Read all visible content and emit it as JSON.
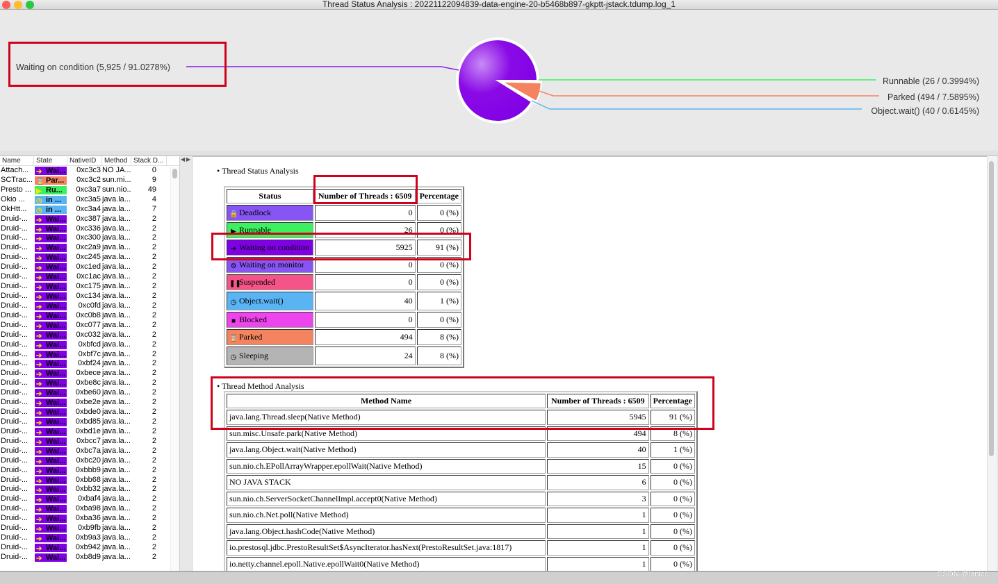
{
  "window": {
    "title": "Thread Status Analysis : 20221122094839-data-engine-20-b5468b897-gkptt-jstack.tdump.log_1"
  },
  "pie": {
    "labels": {
      "waiting": "Waiting on condition (5,925  / 91.0278%)",
      "runnable": "Runnable (26  / 0.3994%)",
      "parked": "Parked (494  / 7.5895%)",
      "objectwait": "Object.wait() (40  / 0.6145%)"
    },
    "slices": [
      {
        "name": "Runnable",
        "value": 26,
        "color": "#3cf060"
      },
      {
        "name": "Parked",
        "value": 494,
        "color": "#f4845f"
      },
      {
        "name": "Object.wait()",
        "value": 40,
        "color": "#5ab4f4"
      },
      {
        "name": "Waiting on condition",
        "value": 5925,
        "color": "#8000e6"
      }
    ]
  },
  "thread_list": {
    "columns": [
      "Name",
      "State",
      "NativeID",
      "Method",
      "Stack D..."
    ],
    "rows": [
      [
        "Attach...",
        "Wai...",
        "0xc3c3",
        "NO JA...",
        "0",
        "waiting"
      ],
      [
        "SCTrac...",
        "Par...",
        "0xc3c2",
        "sun.mi...",
        "9",
        "parked"
      ],
      [
        "Presto ...",
        "Ru...",
        "0xc3a7",
        "sun.nio...",
        "49",
        "runnable"
      ],
      [
        "Okio ...",
        "in ...",
        "0xc3a5",
        "java.la...",
        "4",
        "objectwait"
      ],
      [
        "OkHtt...",
        "in ...",
        "0xc3a4",
        "java.la...",
        "7",
        "objectwait"
      ],
      [
        "Druid-...",
        "Wai...",
        "0xc387",
        "java.la...",
        "2",
        "waiting"
      ],
      [
        "Druid-...",
        "Wai...",
        "0xc336",
        "java.la...",
        "2",
        "waiting"
      ],
      [
        "Druid-...",
        "Wai...",
        "0xc300",
        "java.la...",
        "2",
        "waiting"
      ],
      [
        "Druid-...",
        "Wai...",
        "0xc2a9",
        "java.la...",
        "2",
        "waiting"
      ],
      [
        "Druid-...",
        "Wai...",
        "0xc245",
        "java.la...",
        "2",
        "waiting"
      ],
      [
        "Druid-...",
        "Wai...",
        "0xc1ed",
        "java.la...",
        "2",
        "waiting"
      ],
      [
        "Druid-...",
        "Wai...",
        "0xc1ac",
        "java.la...",
        "2",
        "waiting"
      ],
      [
        "Druid-...",
        "Wai...",
        "0xc175",
        "java.la...",
        "2",
        "waiting"
      ],
      [
        "Druid-...",
        "Wai...",
        "0xc134",
        "java.la...",
        "2",
        "waiting"
      ],
      [
        "Druid-...",
        "Wai...",
        "0xc0fd",
        "java.la...",
        "2",
        "waiting"
      ],
      [
        "Druid-...",
        "Wai...",
        "0xc0b8",
        "java.la...",
        "2",
        "waiting"
      ],
      [
        "Druid-...",
        "Wai...",
        "0xc077",
        "java.la...",
        "2",
        "waiting"
      ],
      [
        "Druid-...",
        "Wai...",
        "0xc032",
        "java.la...",
        "2",
        "waiting"
      ],
      [
        "Druid-...",
        "Wai...",
        "0xbfcd",
        "java.la...",
        "2",
        "waiting"
      ],
      [
        "Druid-...",
        "Wai...",
        "0xbf7c",
        "java.la...",
        "2",
        "waiting"
      ],
      [
        "Druid-...",
        "Wai...",
        "0xbf24",
        "java.la...",
        "2",
        "waiting"
      ],
      [
        "Druid-...",
        "Wai...",
        "0xbece",
        "java.la...",
        "2",
        "waiting"
      ],
      [
        "Druid-...",
        "Wai...",
        "0xbe8c",
        "java.la...",
        "2",
        "waiting"
      ],
      [
        "Druid-...",
        "Wai...",
        "0xbe60",
        "java.la...",
        "2",
        "waiting"
      ],
      [
        "Druid-...",
        "Wai...",
        "0xbe2e",
        "java.la...",
        "2",
        "waiting"
      ],
      [
        "Druid-...",
        "Wai...",
        "0xbde0",
        "java.la...",
        "2",
        "waiting"
      ],
      [
        "Druid-...",
        "Wai...",
        "0xbd85",
        "java.la...",
        "2",
        "waiting"
      ],
      [
        "Druid-...",
        "Wai...",
        "0xbd1e",
        "java.la...",
        "2",
        "waiting"
      ],
      [
        "Druid-...",
        "Wai...",
        "0xbcc7",
        "java.la...",
        "2",
        "waiting"
      ],
      [
        "Druid-...",
        "Wai...",
        "0xbc7a",
        "java.la...",
        "2",
        "waiting"
      ],
      [
        "Druid-...",
        "Wai...",
        "0xbc20",
        "java.la...",
        "2",
        "waiting"
      ],
      [
        "Druid-...",
        "Wai...",
        "0xbbb9",
        "java.la...",
        "2",
        "waiting"
      ],
      [
        "Druid-...",
        "Wai...",
        "0xbb68",
        "java.la...",
        "2",
        "waiting"
      ],
      [
        "Druid-...",
        "Wai...",
        "0xbb32",
        "java.la...",
        "2",
        "waiting"
      ],
      [
        "Druid-...",
        "Wai...",
        "0xbaf4",
        "java.la...",
        "2",
        "waiting"
      ],
      [
        "Druid-...",
        "Wai...",
        "0xba98",
        "java.la...",
        "2",
        "waiting"
      ],
      [
        "Druid-...",
        "Wai...",
        "0xba36",
        "java.la...",
        "2",
        "waiting"
      ],
      [
        "Druid-...",
        "Wai...",
        "0xb9fb",
        "java.la...",
        "2",
        "waiting"
      ],
      [
        "Druid-...",
        "Wai...",
        "0xb9a3",
        "java.la...",
        "2",
        "waiting"
      ],
      [
        "Druid-...",
        "Wai...",
        "0xb942",
        "java.la...",
        "2",
        "waiting"
      ],
      [
        "Druid-...",
        "Wai...",
        "0xb8d9",
        "java.la...",
        "2",
        "waiting"
      ]
    ],
    "state_colors": {
      "waiting": "#8000e6",
      "parked": "#f4845f",
      "runnable": "#3cf060",
      "objectwait": "#5ab4f4"
    },
    "state_icons": {
      "waiting": "➔",
      "parked": "⌛",
      "runnable": "▶",
      "objectwait": "◷"
    }
  },
  "status_analysis": {
    "title": "Thread Status Analysis",
    "headers": [
      "Status",
      "Number of Threads : 6509",
      "Percentage"
    ],
    "rows": [
      {
        "status": "Deadlock",
        "count": "0",
        "pct": "0 (%)",
        "color": "#8855f5",
        "icon": "🔒"
      },
      {
        "status": "Runnable",
        "count": "26",
        "pct": "0 (%)",
        "color": "#3cf060",
        "icon": "▶"
      },
      {
        "status": "Waiting on condition",
        "count": "5925",
        "pct": "91 (%)",
        "color": "#8000e6",
        "icon": "➔"
      },
      {
        "status": "Waiting on monitor",
        "count": "0",
        "pct": "0 (%)",
        "color": "#8855f5",
        "icon": "⚙"
      },
      {
        "status": "Suspended",
        "count": "0",
        "pct": "0 (%)",
        "color": "#f5548a",
        "icon": "❚❚"
      },
      {
        "status": "Object.wait()",
        "count": "40",
        "pct": "1 (%)",
        "color": "#5ab4f4",
        "icon": "◷"
      },
      {
        "status": "Blocked",
        "count": "0",
        "pct": "0 (%)",
        "color": "#ee44ee",
        "icon": "■"
      },
      {
        "status": "Parked",
        "count": "494",
        "pct": "8 (%)",
        "color": "#f4845f",
        "icon": "⌛"
      },
      {
        "status": "Sleeping",
        "count": "24",
        "pct": "8 (%)",
        "color": "#b4b4b4",
        "icon": "◷"
      }
    ]
  },
  "method_analysis": {
    "title": "Thread Method Analysis",
    "headers": [
      "Method Name",
      "Number of Threads : 6509",
      "Percentage"
    ],
    "rows": [
      [
        "java.lang.Thread.sleep(Native Method)",
        "5945",
        "91 (%)"
      ],
      [
        "sun.misc.Unsafe.park(Native Method)",
        "494",
        "8 (%)"
      ],
      [
        "java.lang.Object.wait(Native Method)",
        "40",
        "1 (%)"
      ],
      [
        "sun.nio.ch.EPollArrayWrapper.epollWait(Native Method)",
        "15",
        "0 (%)"
      ],
      [
        "NO JAVA STACK",
        "6",
        "0 (%)"
      ],
      [
        "sun.nio.ch.ServerSocketChannelImpl.accept0(Native Method)",
        "3",
        "0 (%)"
      ],
      [
        "sun.nio.ch.Net.poll(Native Method)",
        "1",
        "0 (%)"
      ],
      [
        "java.lang.Object.hashCode(Native Method)",
        "1",
        "0 (%)"
      ],
      [
        "io.prestosql.jdbc.PrestoResultSet$AsyncIterator.hasNext(PrestoResultSet.java:1817)",
        "1",
        "0 (%)"
      ],
      [
        "io.netty.channel.epoll.Native.epollWait0(Native Method)",
        "1",
        "0 (%)"
      ]
    ]
  },
  "watermark": "CSDN @lanicc"
}
